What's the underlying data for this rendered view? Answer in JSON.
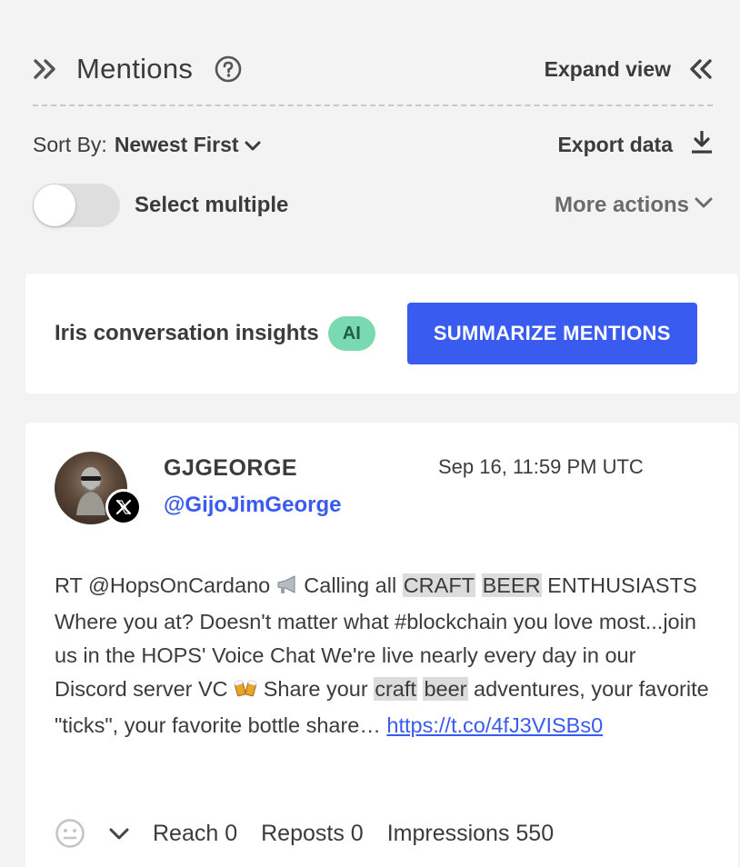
{
  "header": {
    "title": "Mentions",
    "expand_label": "Expand view"
  },
  "sort": {
    "label": "Sort By:",
    "value": "Newest First"
  },
  "export_label": "Export data",
  "select_multiple": {
    "label": "Select multiple",
    "enabled": false
  },
  "more_actions_label": "More actions",
  "insights": {
    "label": "Iris conversation insights",
    "badge": "AI",
    "button_label": "SUMMARIZE MENTIONS"
  },
  "mention": {
    "author_name": "GJGEORGE",
    "handle": "@GijoJimGeorge",
    "timestamp": "Sep 16, 11:59 PM UTC",
    "platform_icon": "x-icon",
    "text": {
      "p1": "RT @HopsOnCardano ",
      "p2": " Calling all ",
      "hl1": "CRAFT",
      "hl2": "BEER",
      "p3": " ENTHUSIASTS Where you at? Doesn't matter what #blockchain you love most...join us in the HOPS' Voice Chat We're live nearly every day in our Discord server VC ",
      "p4": " Share your ",
      "hl3": "craft",
      "hl4": "beer",
      "p5": " adventures, your favorite \"ticks\", your favorite bottle share… ",
      "link": "https://t.co/4fJ3VISBs0"
    },
    "stats": {
      "reach": "Reach 0",
      "reposts": "Reposts 0",
      "impressions": "Impressions 550"
    }
  },
  "colors": {
    "accent": "#3a5bf0",
    "ai_badge": "#7ad9b1",
    "highlight": "#dcdcdc",
    "background": "#f3f3f3"
  }
}
